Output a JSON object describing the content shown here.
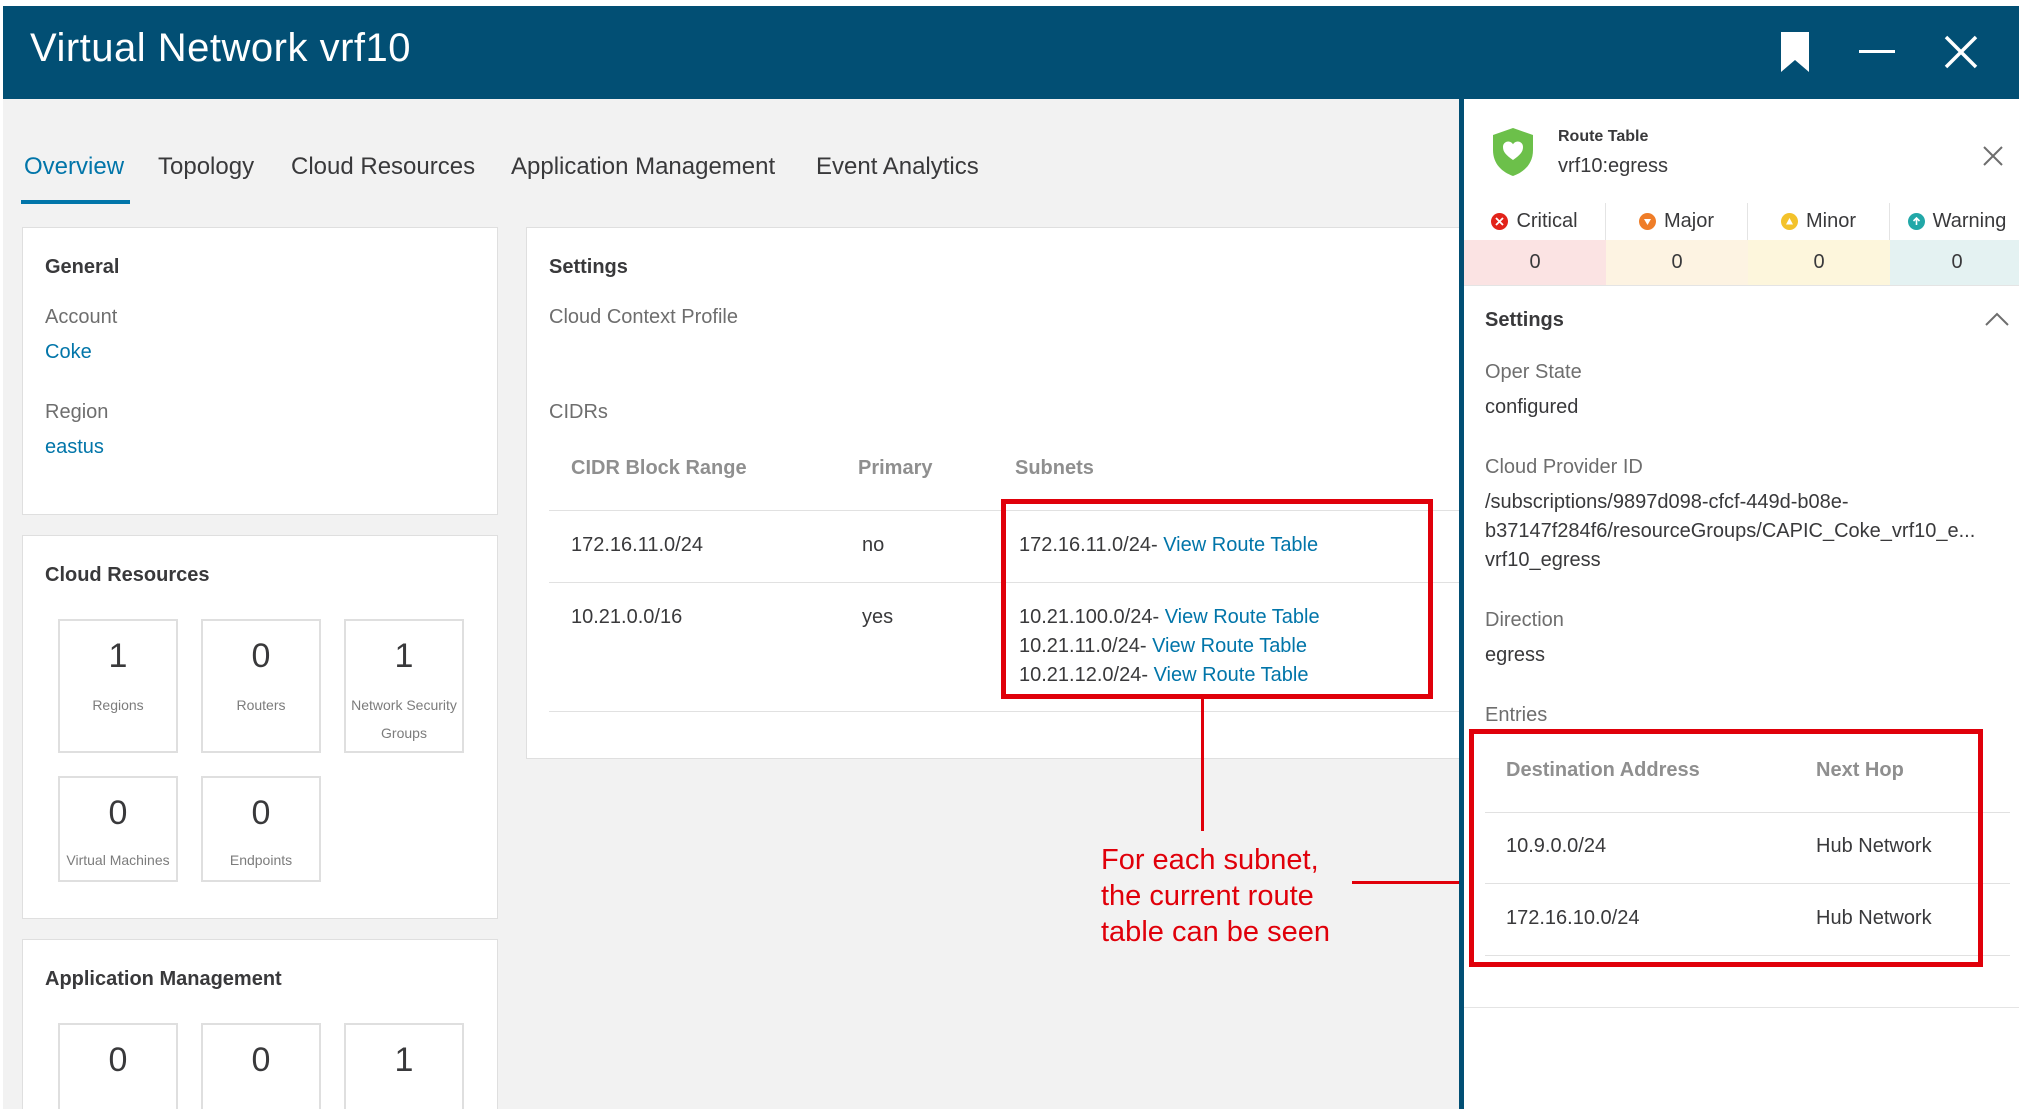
{
  "window": {
    "title": "Virtual Network vrf10"
  },
  "tabs": [
    "Overview",
    "Topology",
    "Cloud Resources",
    "Application Management",
    "Event Analytics"
  ],
  "general": {
    "title": "General",
    "account_label": "Account",
    "account_value": "Coke",
    "region_label": "Region",
    "region_value": "eastus"
  },
  "cloud_resources": {
    "title": "Cloud Resources",
    "tiles": [
      {
        "count": "1",
        "label": "Regions"
      },
      {
        "count": "0",
        "label": "Routers"
      },
      {
        "count": "1",
        "label": "Network Security Groups"
      },
      {
        "count": "0",
        "label": "Virtual Machines"
      },
      {
        "count": "0",
        "label": "Endpoints"
      }
    ]
  },
  "app_management": {
    "title": "Application Management",
    "tiles": [
      {
        "count": "0"
      },
      {
        "count": "0"
      },
      {
        "count": "1"
      }
    ]
  },
  "settings": {
    "title": "Settings",
    "cloud_context_label": "Cloud Context Profile",
    "cidrs_label": "CIDRs",
    "columns": [
      "CIDR Block Range",
      "Primary",
      "Subnets"
    ],
    "rows": [
      {
        "cidr": "172.16.11.0/24",
        "primary": "no",
        "subnets": [
          {
            "subnet": "172.16.11.0/24",
            "sep": "- ",
            "link": "View Route Table"
          }
        ]
      },
      {
        "cidr": "10.21.0.0/16",
        "primary": "yes",
        "subnets": [
          {
            "subnet": "10.21.100.0/24",
            "sep": "- ",
            "link": "View Route Table"
          },
          {
            "subnet": "10.21.11.0/24",
            "sep": "- ",
            "link": "View Route Table"
          },
          {
            "subnet": "10.21.12.0/24",
            "sep": "- ",
            "link": "View Route Table"
          }
        ]
      }
    ]
  },
  "annotation": {
    "lines": [
      "For each subnet,",
      "the current route",
      "table can be seen"
    ]
  },
  "panel": {
    "kind": "Route Table",
    "name": "vrf10:egress",
    "severity": [
      {
        "label": "Critical",
        "count": "0",
        "color": "#e2231a",
        "bg": "#fbe3e3"
      },
      {
        "label": "Major",
        "count": "0",
        "color": "#ef7d28",
        "bg": "#fdf3e2"
      },
      {
        "label": "Minor",
        "count": "0",
        "color": "#f3c22b",
        "bg": "#fdf6dc"
      },
      {
        "label": "Warning",
        "count": "0",
        "color": "#22a8a8",
        "bg": "#e4f2f2"
      }
    ],
    "settings_title": "Settings",
    "oper_state_label": "Oper State",
    "oper_state_value": "configured",
    "provider_id_label": "Cloud Provider ID",
    "provider_id_lines": [
      "/subscriptions/9897d098-cfcf-449d-b08e-",
      "b37147f284f6/resourceGroups/CAPIC_Coke_vrf10_e...",
      "vrf10_egress"
    ],
    "direction_label": "Direction",
    "direction_value": "egress",
    "entries_label": "Entries",
    "entries_columns": [
      "Destination Address",
      "Next Hop"
    ],
    "entries": [
      {
        "destination": "10.9.0.0/24",
        "next_hop": "Hub Network"
      },
      {
        "destination": "172.16.10.0/24",
        "next_hop": "Hub Network"
      }
    ]
  }
}
